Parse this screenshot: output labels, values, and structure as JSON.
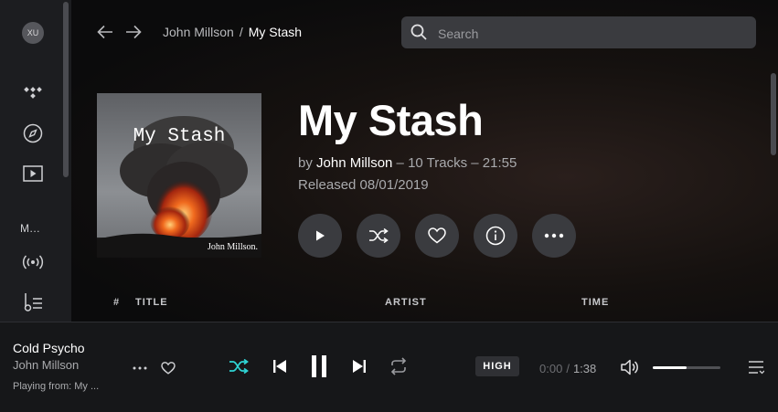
{
  "sidebar": {
    "avatar_initials": "XU",
    "section_label": "M...",
    "icons": [
      "tidal-logo-icon",
      "compass-icon",
      "video-icon",
      "radio-icon",
      "playlist-icon"
    ]
  },
  "header": {
    "breadcrumb": {
      "artist": "John Millson",
      "separator": "/",
      "current": "My Stash"
    },
    "search": {
      "placeholder": "Search",
      "value": ""
    }
  },
  "album": {
    "cover_title": "My Stash",
    "cover_artist": "John Millson.",
    "title": "My Stash",
    "by_prefix": "by",
    "artist": "John Millson",
    "meta_suffix": " – 10 Tracks – 21:55",
    "released": "Released 08/01/2019",
    "actions": [
      "play",
      "shuffle",
      "favorite",
      "info",
      "more"
    ]
  },
  "tracklist": {
    "columns": {
      "number": "#",
      "title": "TITLE",
      "artist": "ARTIST",
      "time": "TIME"
    }
  },
  "player": {
    "track_title": "Cold Psycho",
    "track_artist": "John Millson",
    "playing_from": "Playing from:  My ...",
    "quality": "HIGH",
    "elapsed": "0:00",
    "time_separator": "/",
    "duration": "1:38",
    "volume_fraction": 0.5,
    "shuffle_active": true
  },
  "colors": {
    "accent": "#2fd4d4",
    "button_bg": "#3a3b3f",
    "sidebar_bg": "#1c1d20",
    "player_bg": "#161719"
  }
}
